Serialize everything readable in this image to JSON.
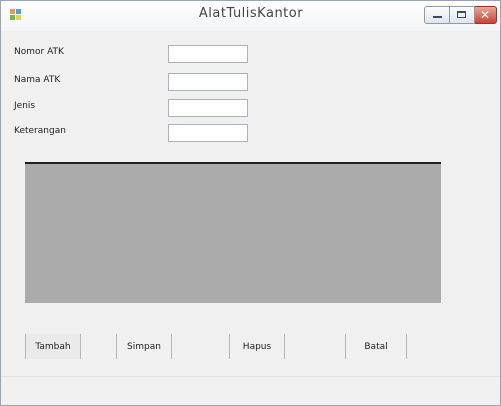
{
  "window": {
    "title": "AlatTulisKantor",
    "controls": [
      "minimize",
      "maximize",
      "close"
    ]
  },
  "form": {
    "fields": [
      {
        "label": "Nomor ATK",
        "value": ""
      },
      {
        "label": "Nama ATK",
        "value": ""
      },
      {
        "label": "Jenis",
        "value": ""
      },
      {
        "label": "Keterangan",
        "value": ""
      }
    ]
  },
  "grid": {
    "rows": [],
    "background": "#ababab"
  },
  "buttons": {
    "tambah": "Tambah",
    "simpan": "Simpan",
    "hapus": "Hapus",
    "batal": "Batal"
  },
  "colors": {
    "window_bg": "#f0f0f0",
    "grid_bg": "#ababab",
    "close_red": "#c7452f"
  }
}
